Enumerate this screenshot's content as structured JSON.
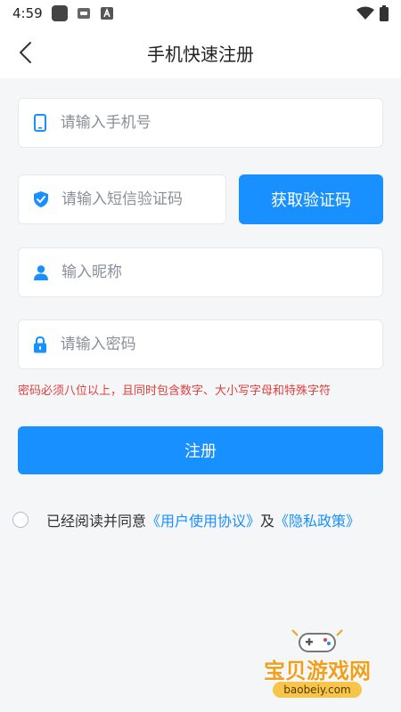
{
  "status_bar": {
    "time": "4:59",
    "icons": [
      "app-square-icon",
      "notification-icon",
      "a-icon",
      "wifi-icon",
      "battery-icon"
    ]
  },
  "nav": {
    "title": "手机快速注册",
    "back_icon": "chevron-left-icon"
  },
  "form": {
    "phone": {
      "placeholder": "请输入手机号",
      "value": "",
      "icon": "phone-icon"
    },
    "sms_code": {
      "placeholder": "请输入短信验证码",
      "value": "",
      "icon": "shield-icon"
    },
    "get_code_label": "获取验证码",
    "nickname": {
      "placeholder": "输入昵称",
      "value": "",
      "icon": "user-icon"
    },
    "password": {
      "placeholder": "请输入密码",
      "value": "",
      "icon": "lock-icon"
    },
    "password_hint": "密码必须八位以上，且同时包含数字、大小写字母和特殊字符",
    "register_label": "注册"
  },
  "agreement": {
    "prefix": "已经阅读并同意",
    "user_agreement": "《用户使用协议》",
    "and": "及",
    "privacy_policy": "《隐私政策》",
    "checked": false
  },
  "watermark": {
    "title": "宝贝游戏网",
    "url": "baobeiy.com"
  },
  "colors": {
    "accent": "#1890ff",
    "hint": "#e0403e",
    "background": "#f5f6f8"
  }
}
